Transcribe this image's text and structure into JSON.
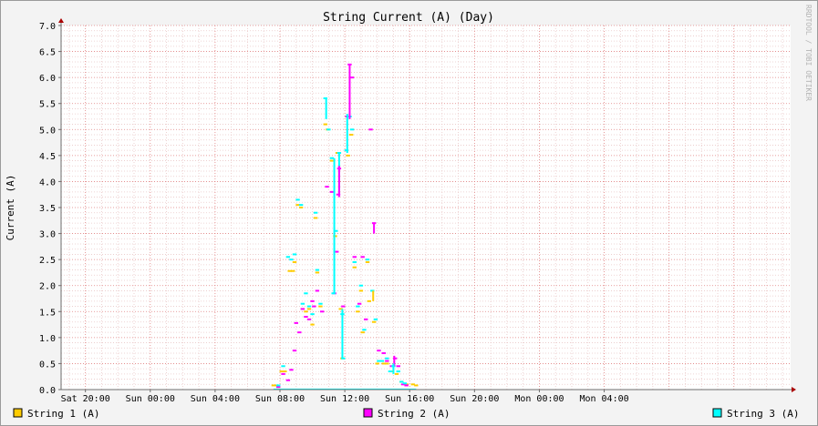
{
  "chart_data": {
    "type": "line",
    "title": "String Current (A) (Day)",
    "ylabel": "Current (A)",
    "xlabel": "",
    "watermark": "RRDTOOL / TOBI OETIKER",
    "ylim": [
      0,
      7
    ],
    "yticks": [
      "0.0",
      "0.5",
      "1.0",
      "1.5",
      "2.0",
      "2.5",
      "3.0",
      "3.5",
      "4.0",
      "4.5",
      "5.0",
      "5.5",
      "6.0",
      "6.5",
      "7.0"
    ],
    "xrange_hours": [
      -5.5,
      39.5
    ],
    "xticks": [
      {
        "label": "Sat 20:00",
        "h": -4
      },
      {
        "label": "Sun 00:00",
        "h": 0
      },
      {
        "label": "Sun 04:00",
        "h": 4
      },
      {
        "label": "Sun 08:00",
        "h": 8
      },
      {
        "label": "Sun 12:00",
        "h": 12
      },
      {
        "label": "Sun 16:00",
        "h": 16
      },
      {
        "label": "Sun 20:00",
        "h": 20
      },
      {
        "label": "Mon 00:00",
        "h": 24
      },
      {
        "label": "Mon 04:00",
        "h": 28
      }
    ],
    "grid": true,
    "legend_position": "bottom",
    "colors": {
      "background": "#f3f3f3",
      "plot_background": "#ffffff",
      "grid_minor": "#e9c8c8",
      "grid_major": "#e07f7f",
      "axis": "#6e6e6e",
      "arrow": "#aa0000"
    },
    "series": [
      {
        "name": "String 1 (A)",
        "color": "#ffcc00",
        "points": [
          [
            7.6,
            0.08
          ],
          [
            7.8,
            0.08
          ],
          [
            7.9,
            0.05
          ],
          [
            8.1,
            0.35
          ],
          [
            8.3,
            0.35
          ],
          [
            8.6,
            2.28
          ],
          [
            8.8,
            2.28
          ],
          [
            8.9,
            2.45
          ],
          [
            9.1,
            3.55
          ],
          [
            9.3,
            3.5
          ],
          [
            9.4,
            1.55
          ],
          [
            9.6,
            1.5
          ],
          [
            9.8,
            1.55
          ],
          [
            10.0,
            1.25
          ],
          [
            10.2,
            3.3
          ],
          [
            10.3,
            2.25
          ],
          [
            10.5,
            1.6
          ],
          [
            10.8,
            5.1
          ],
          [
            10.95,
            5.0
          ],
          [
            11.2,
            4.4
          ],
          [
            11.4,
            2.95
          ],
          [
            11.55,
            4.55
          ],
          [
            11.75,
            1.55
          ],
          [
            11.85,
            0.6
          ],
          [
            12.2,
            4.5
          ],
          [
            12.4,
            4.9
          ],
          [
            12.6,
            2.35
          ],
          [
            12.8,
            1.5
          ],
          [
            13.0,
            1.9
          ],
          [
            13.1,
            1.1
          ],
          [
            13.4,
            2.45
          ],
          [
            13.5,
            1.7
          ],
          [
            13.8,
            1.3
          ],
          [
            14.0,
            0.5
          ],
          [
            14.4,
            0.5
          ],
          [
            14.6,
            0.5
          ],
          [
            14.9,
            0.35
          ],
          [
            15.2,
            0.3
          ],
          [
            15.5,
            0.15
          ],
          [
            15.8,
            0.1
          ],
          [
            16.2,
            0.1
          ],
          [
            16.4,
            0.08
          ]
        ]
      },
      {
        "name": "String 2 (A)",
        "color": "#ff00ff",
        "points": [
          [
            7.9,
            0.05
          ],
          [
            8.2,
            0.3
          ],
          [
            8.5,
            0.18
          ],
          [
            8.7,
            0.38
          ],
          [
            8.9,
            0.75
          ],
          [
            9.0,
            1.28
          ],
          [
            9.2,
            1.1
          ],
          [
            9.4,
            1.55
          ],
          [
            9.6,
            1.4
          ],
          [
            9.8,
            1.35
          ],
          [
            10.0,
            1.7
          ],
          [
            10.1,
            1.6
          ],
          [
            10.3,
            1.9
          ],
          [
            10.6,
            1.5
          ],
          [
            10.9,
            3.9
          ],
          [
            11.2,
            3.8
          ],
          [
            11.35,
            1.85
          ],
          [
            11.5,
            2.65
          ],
          [
            11.6,
            3.75
          ],
          [
            11.65,
            4.25
          ],
          [
            11.9,
            1.6
          ],
          [
            12.15,
            5.25
          ],
          [
            12.3,
            6.25
          ],
          [
            12.45,
            6.0
          ],
          [
            12.6,
            2.55
          ],
          [
            12.9,
            1.65
          ],
          [
            13.1,
            2.55
          ],
          [
            13.3,
            1.35
          ],
          [
            13.6,
            5.0
          ],
          [
            13.8,
            3.2
          ],
          [
            14.1,
            0.75
          ],
          [
            14.4,
            0.7
          ],
          [
            14.6,
            0.55
          ],
          [
            14.9,
            0.45
          ],
          [
            15.1,
            0.6
          ],
          [
            15.3,
            0.45
          ],
          [
            15.6,
            0.1
          ],
          [
            15.8,
            0.08
          ]
        ]
      },
      {
        "name": "String 3 (A)",
        "color": "#00ffff",
        "points": [
          [
            7.9,
            0.08
          ],
          [
            8.2,
            0.45
          ],
          [
            8.5,
            2.55
          ],
          [
            8.7,
            2.5
          ],
          [
            8.9,
            2.6
          ],
          [
            9.1,
            3.65
          ],
          [
            9.3,
            3.55
          ],
          [
            9.4,
            1.65
          ],
          [
            9.6,
            1.85
          ],
          [
            9.8,
            1.6
          ],
          [
            10.0,
            1.45
          ],
          [
            10.2,
            3.4
          ],
          [
            10.3,
            2.3
          ],
          [
            10.5,
            1.65
          ],
          [
            10.8,
            5.6
          ],
          [
            11.0,
            5.0
          ],
          [
            11.2,
            4.45
          ],
          [
            11.3,
            1.85
          ],
          [
            11.45,
            3.05
          ],
          [
            11.65,
            4.55
          ],
          [
            11.85,
            1.45
          ],
          [
            11.9,
            0.6
          ],
          [
            12.1,
            4.6
          ],
          [
            12.3,
            5.25
          ],
          [
            12.45,
            5.0
          ],
          [
            12.6,
            2.45
          ],
          [
            12.8,
            1.6
          ],
          [
            13.0,
            2.0
          ],
          [
            13.2,
            1.15
          ],
          [
            13.4,
            2.5
          ],
          [
            13.7,
            1.9
          ],
          [
            13.9,
            1.35
          ],
          [
            14.1,
            0.55
          ],
          [
            14.3,
            0.55
          ],
          [
            14.6,
            0.6
          ],
          [
            14.8,
            0.35
          ],
          [
            15.0,
            0.45
          ],
          [
            15.3,
            0.35
          ],
          [
            15.5,
            0.15
          ],
          [
            15.7,
            0.12
          ]
        ]
      }
    ],
    "spikes": [
      {
        "series": 2,
        "x": 11.35,
        "y0": 1.85,
        "y1": 4.45
      },
      {
        "series": 2,
        "x": 11.65,
        "y0": 3.75,
        "y1": 4.55
      },
      {
        "series": 2,
        "x": 11.85,
        "y0": 0.6,
        "y1": 1.55
      },
      {
        "series": 2,
        "x": 10.85,
        "y0": 5.2,
        "y1": 5.6
      },
      {
        "series": 1,
        "x": 12.3,
        "y0": 5.2,
        "y1": 6.25
      },
      {
        "series": 1,
        "x": 11.65,
        "y0": 3.7,
        "y1": 4.3
      },
      {
        "series": 2,
        "x": 12.15,
        "y0": 4.55,
        "y1": 5.3
      },
      {
        "series": 1,
        "x": 13.8,
        "y0": 3.0,
        "y1": 3.2
      },
      {
        "series": 0,
        "x": 13.75,
        "y0": 1.7,
        "y1": 1.9
      },
      {
        "series": 1,
        "x": 15.05,
        "y0": 0.45,
        "y1": 0.65
      },
      {
        "series": 2,
        "x": 15.0,
        "y0": 0.3,
        "y1": 0.5
      }
    ]
  }
}
